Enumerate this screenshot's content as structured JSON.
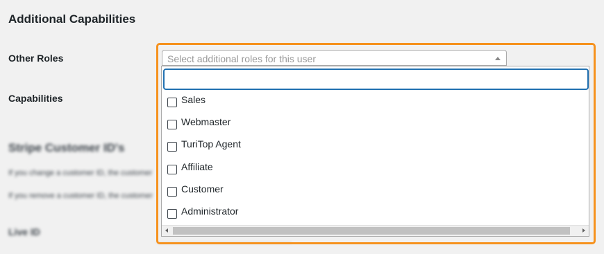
{
  "section_title": "Additional Capabilities",
  "labels": {
    "other_roles": "Other Roles",
    "capabilities": "Capabilities"
  },
  "roles_select": {
    "placeholder": "Select additional roles for this user",
    "search_value": "",
    "options": [
      {
        "label": "Sales",
        "checked": false
      },
      {
        "label": "Webmaster",
        "checked": false
      },
      {
        "label": "TuriTop Agent",
        "checked": false
      },
      {
        "label": "Affiliate",
        "checked": false
      },
      {
        "label": "Customer",
        "checked": false
      },
      {
        "label": "Administrator",
        "checked": false
      }
    ]
  },
  "background": {
    "stripe_heading": "Stripe Customer ID's",
    "desc_1": "If you change a customer ID, the customer",
    "desc_2": "If you remove a customer ID, the customer",
    "live_id": "Live ID"
  },
  "colors": {
    "highlight": "#f6921e",
    "focus": "#2271b1"
  },
  "icons": {
    "dropdown_arrow": "triangle-up-icon",
    "scroll_left": "triangle-left-icon",
    "scroll_right": "triangle-right-icon"
  }
}
